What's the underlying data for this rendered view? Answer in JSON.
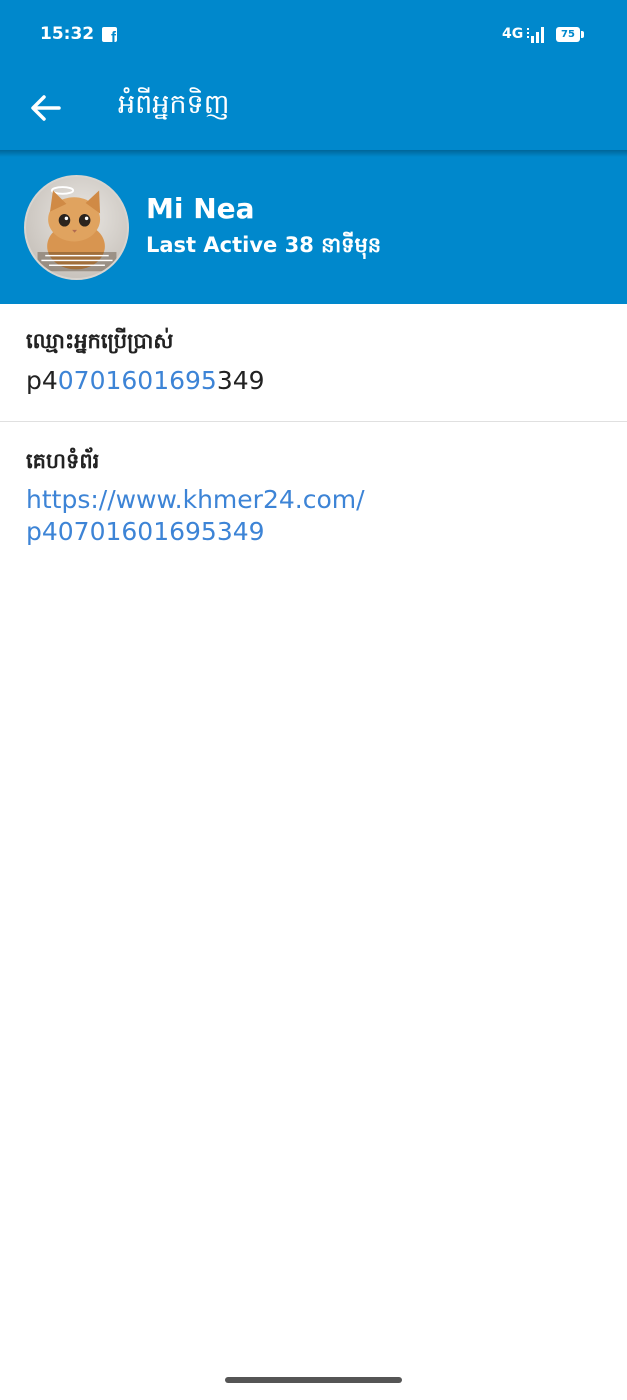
{
  "status_bar": {
    "time": "15:32",
    "notification_icon": "facebook-icon",
    "network": "4G",
    "battery": "75"
  },
  "app_bar": {
    "back_icon": "arrow-left-icon",
    "title": "អំពីអ្នកទិញ"
  },
  "profile": {
    "name": "Mi Nea",
    "last_active": "Last Active 38 នាទីមុន"
  },
  "fields": {
    "username_label": "ឈ្មោះអ្នកប្រើប្រាស់",
    "username_prefix": "p4",
    "username_link": "0701601695",
    "username_suffix": "349",
    "website_label": "គេហទំព័រ",
    "website_line1": "https://www.khmer24.com/",
    "website_line2": "p40701601695349"
  },
  "colors": {
    "primary": "#0088cc",
    "link": "#3d84d6",
    "text": "#222222"
  }
}
